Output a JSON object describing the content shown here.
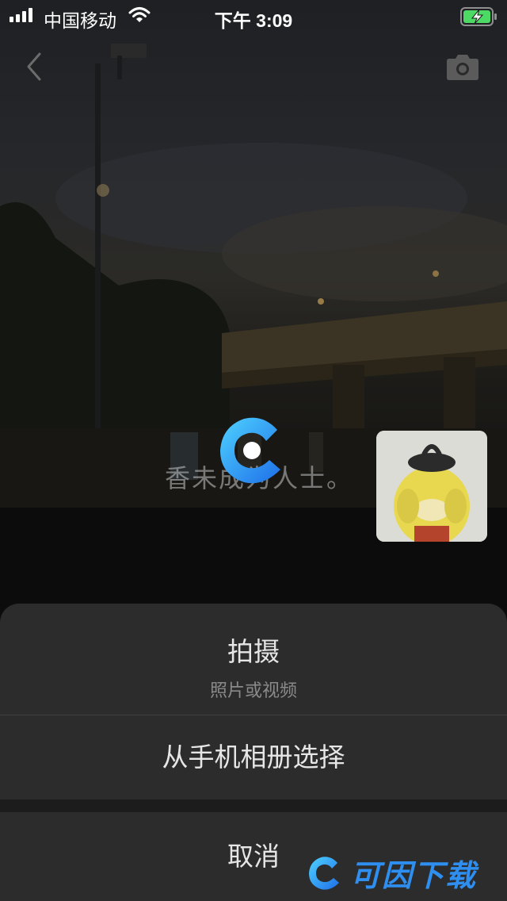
{
  "status_bar": {
    "carrier": "中国移动",
    "time": "下午 3:09",
    "signal_bars": 4,
    "battery_state": "charging"
  },
  "nav": {
    "back_icon": "chevron-left-icon",
    "camera_icon": "camera-icon"
  },
  "background": {
    "sign_text": "香未成为人士。"
  },
  "action_sheet": {
    "take_label": "拍摄",
    "take_sublabel": "照片或视频",
    "album_label": "从手机相册选择",
    "cancel_label": "取消"
  },
  "watermark": {
    "text": "可因下载"
  },
  "colors": {
    "sheet_bg": "#2c2c2c",
    "battery_green": "#4cd964",
    "logo_blue": "#1e7fe8"
  }
}
